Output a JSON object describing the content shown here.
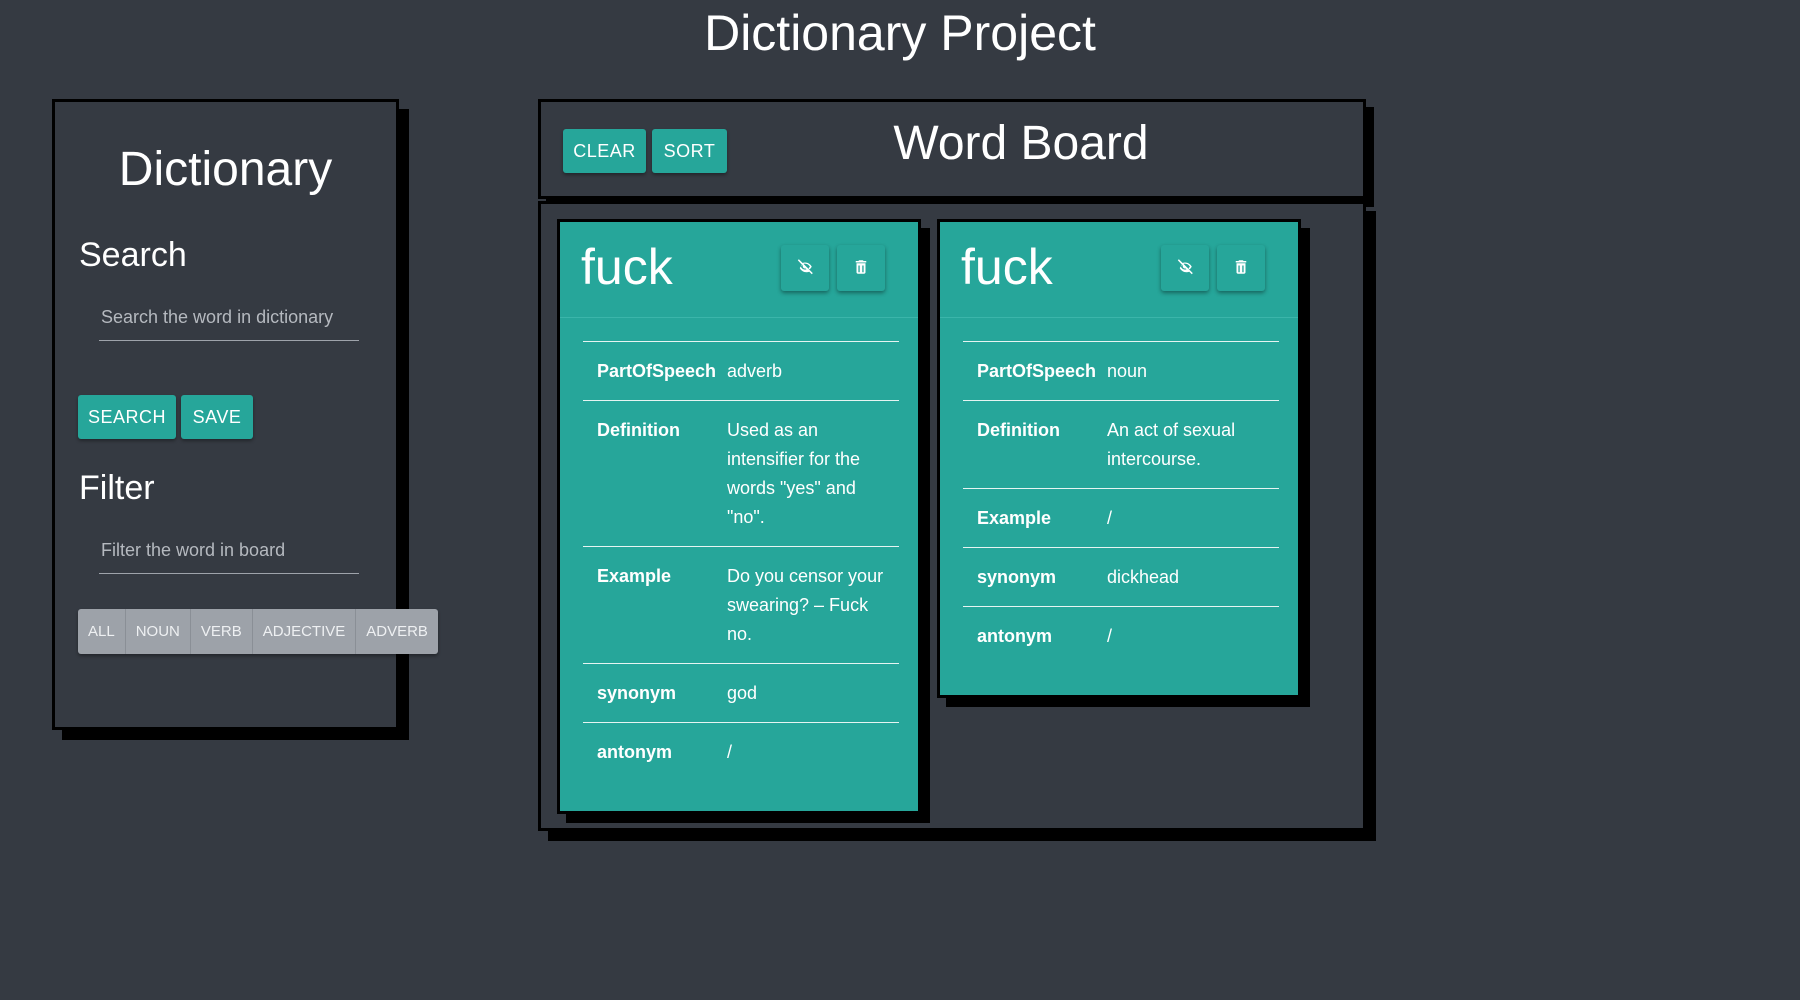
{
  "page": {
    "title": "Dictionary Project"
  },
  "sidebar": {
    "title": "Dictionary",
    "search": {
      "heading": "Search",
      "placeholder": "Search the word in dictionary",
      "search_label": "SEARCH",
      "save_label": "SAVE"
    },
    "filter": {
      "heading": "Filter",
      "placeholder": "Filter the word in board",
      "options": [
        "ALL",
        "NOUN",
        "VERB",
        "ADJECTIVE",
        "ADVERB"
      ]
    }
  },
  "board": {
    "title": "Word Board",
    "clear_label": "CLEAR",
    "sort_label": "SORT",
    "cards": [
      {
        "word": "fuck",
        "rows": [
          {
            "key": "PartOfSpeech",
            "value": "adverb"
          },
          {
            "key": "Definition",
            "value": "Used as an intensifier for the words \"yes\" and \"no\"."
          },
          {
            "key": "Example",
            "value": "Do you censor your swearing? – Fuck no."
          },
          {
            "key": "synonym",
            "value": "god"
          },
          {
            "key": "antonym",
            "value": "/"
          }
        ]
      },
      {
        "word": "fuck",
        "rows": [
          {
            "key": "PartOfSpeech",
            "value": "noun"
          },
          {
            "key": "Definition",
            "value": "An act of sexual intercourse."
          },
          {
            "key": "Example",
            "value": "/"
          },
          {
            "key": "synonym",
            "value": "dickhead"
          },
          {
            "key": "antonym",
            "value": "/"
          }
        ]
      }
    ]
  },
  "colors": {
    "background": "#353a42",
    "accent": "#26a69a",
    "filter_button": "#9da2a9",
    "border": "#000000"
  },
  "icons": {
    "hide": "eye-off-icon",
    "delete": "trash-icon"
  }
}
